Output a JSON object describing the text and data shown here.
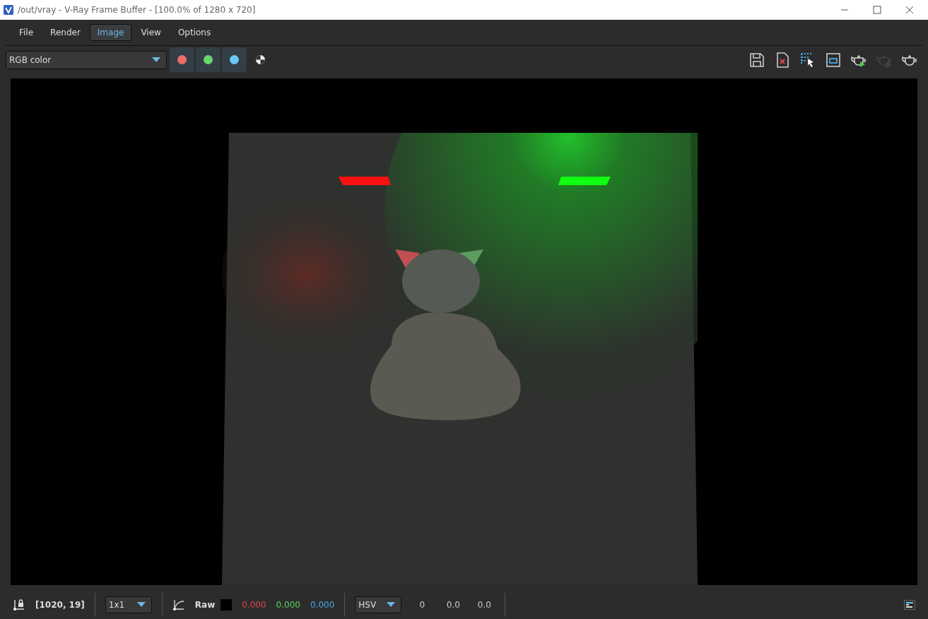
{
  "window": {
    "title": "/out/vray - V-Ray Frame Buffer - [100.0% of 1280 x 720]"
  },
  "menu": [
    {
      "label": "File",
      "selected": false
    },
    {
      "label": "Render",
      "selected": false
    },
    {
      "label": "Image",
      "selected": true
    },
    {
      "label": "View",
      "selected": false
    },
    {
      "label": "Options",
      "selected": false
    }
  ],
  "toolbar": {
    "channel_select": "RGB color",
    "channels": [
      {
        "color": "#f06b6b",
        "on": true
      },
      {
        "color": "#6bd66b",
        "on": true
      },
      {
        "color": "#6bc8f5",
        "on": true
      }
    ],
    "actions": [
      {
        "kind": "save",
        "disabled": false
      },
      {
        "kind": "clear",
        "disabled": false
      },
      {
        "kind": "region",
        "disabled": false
      },
      {
        "kind": "fit",
        "disabled": false
      },
      {
        "kind": "render",
        "disabled": false
      },
      {
        "kind": "stop",
        "disabled": true
      },
      {
        "kind": "teapot",
        "disabled": false
      }
    ]
  },
  "status_bar": {
    "coordinates": "[1020, 19]",
    "sample_size": "1x1",
    "mode": "Raw",
    "rgb_values": [
      {
        "text": "0.000",
        "color": "#e04848"
      },
      {
        "text": "0.000",
        "color": "#5ad45a"
      },
      {
        "text": "0.000",
        "color": "#4aa8e8"
      }
    ],
    "color_space": "HSV",
    "hsv_values": [
      "0",
      "0.0",
      "0.0"
    ]
  }
}
